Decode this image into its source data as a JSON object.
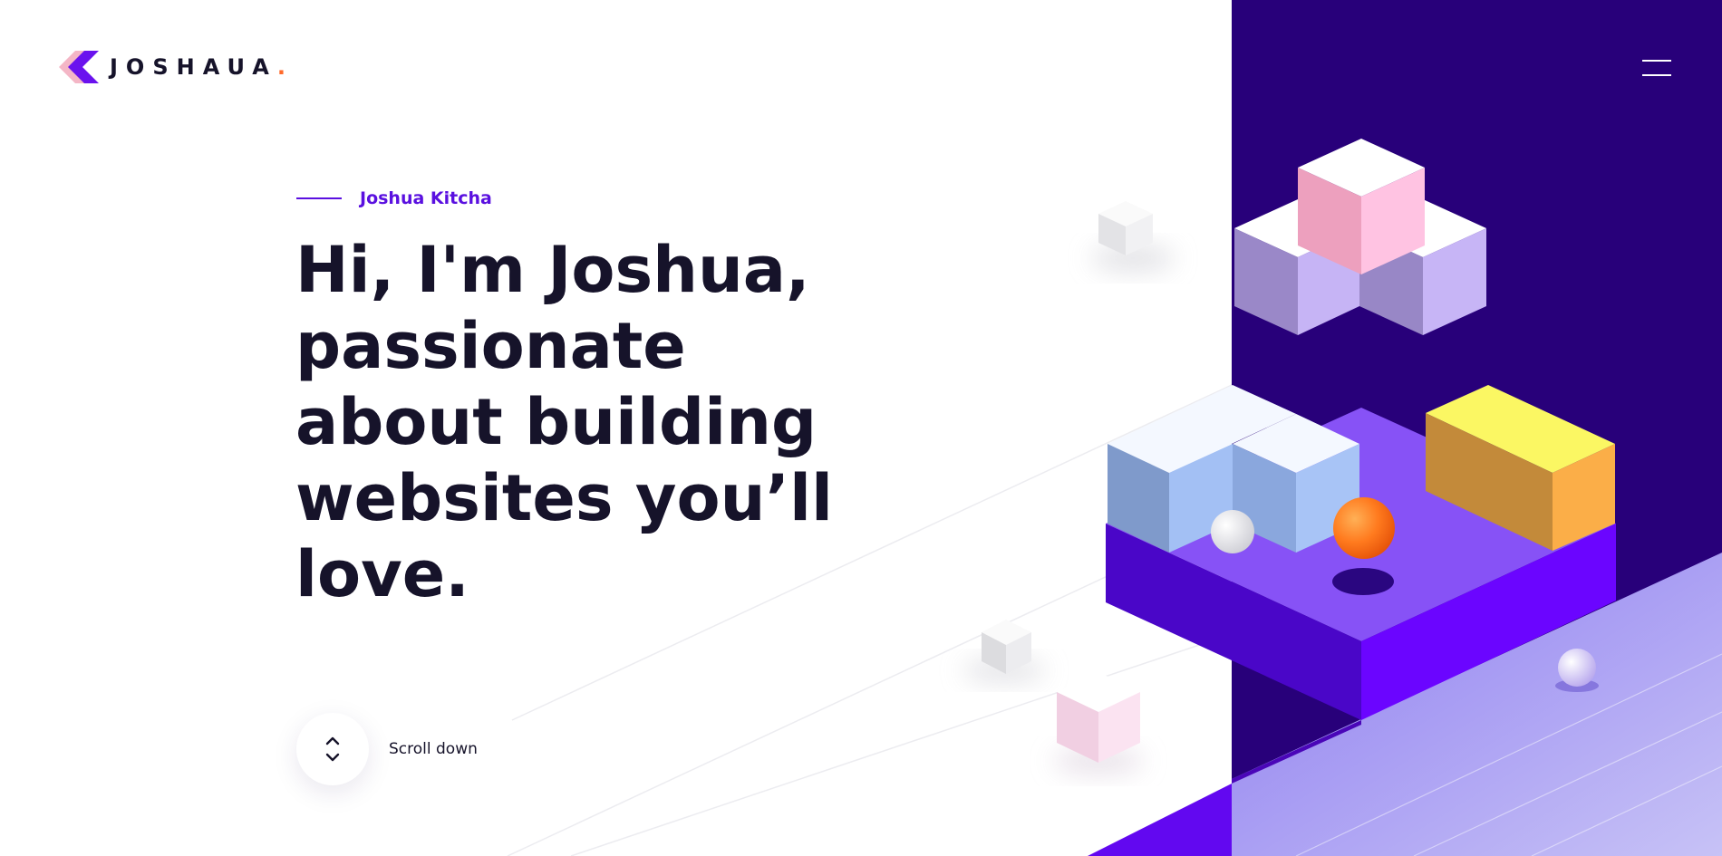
{
  "brand": {
    "name": "JOSHAUA",
    "dot": ".",
    "mark_icon": "chevron-logo-icon"
  },
  "menu": {
    "icon": "hamburger-menu-icon"
  },
  "hero": {
    "eyebrow": "Joshua Kitcha",
    "title_lines": [
      "Hi, I'm Joshua,",
      "passionate",
      "about building",
      "websites you’ll",
      "love."
    ]
  },
  "scroll": {
    "label": "Scroll down",
    "icon": "scroll-arrows-icon"
  },
  "colors": {
    "accent": "#5a10e0",
    "dark_panel": "#28007a",
    "heading": "#16132a",
    "brand_dot": "#ff6a2b"
  }
}
